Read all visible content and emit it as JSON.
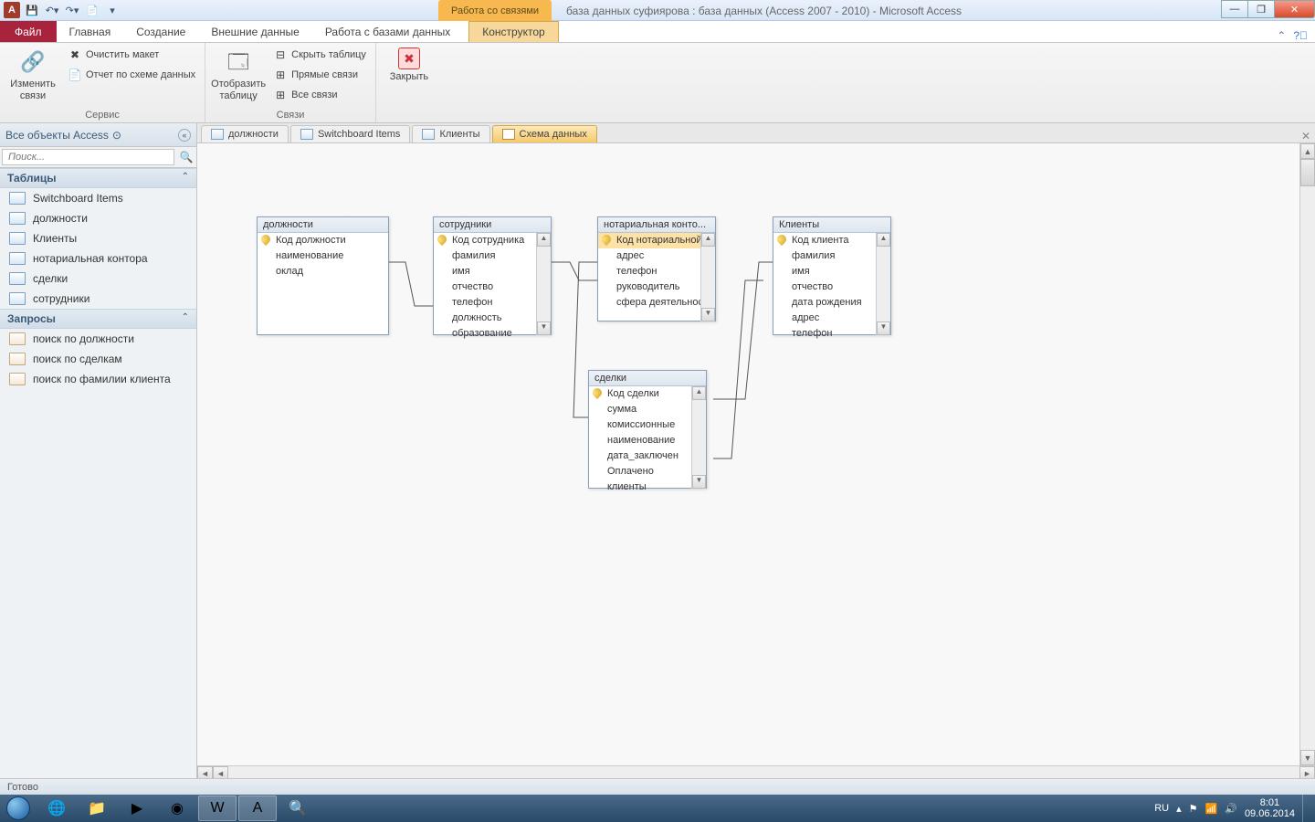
{
  "title": {
    "context_tab": "Работа со связями",
    "window_title": "база данных суфиярова : база данных (Access 2007 - 2010)  -  Microsoft Access"
  },
  "ribbon_tabs": {
    "file": "Файл",
    "home": "Главная",
    "create": "Создание",
    "external": "Внешние данные",
    "dbtools": "Работа с базами данных",
    "design": "Конструктор"
  },
  "ribbon": {
    "g1": {
      "edit_rel": "Изменить связи",
      "clear_layout": "Очистить макет",
      "rel_report": "Отчет по схеме данных",
      "label": "Сервис"
    },
    "g2": {
      "show_table": "Отобразить таблицу",
      "hide_table": "Скрыть таблицу",
      "direct_rel": "Прямые связи",
      "all_rel": "Все связи",
      "label": "Связи"
    },
    "g3": {
      "close": "Закрыть"
    }
  },
  "nav": {
    "header": "Все объекты Access",
    "search_placeholder": "Поиск...",
    "tables_hdr": "Таблицы",
    "tables": [
      "Switchboard Items",
      "должности",
      "Клиенты",
      "нотариальная контора",
      "сделки",
      "сотрудники"
    ],
    "queries_hdr": "Запросы",
    "queries": [
      "поиск по должности",
      "поиск по сделкам",
      "поиск по фамилии клиента"
    ]
  },
  "doctabs": {
    "t0": "должности",
    "t1": "Switchboard Items",
    "t2": "Клиенты",
    "t3": "Схема данных"
  },
  "rel": {
    "dolzhnosti": {
      "title": "должности",
      "f0": "Код должности",
      "f1": "наименование",
      "f2": "оклад"
    },
    "sotrudniki": {
      "title": "сотрудники",
      "f0": "Код сотрудника",
      "f1": "фамилия",
      "f2": "имя",
      "f3": "отчество",
      "f4": "телефон",
      "f5": "должность",
      "f6": "образование"
    },
    "notar": {
      "title": "нотариальная конто...",
      "f0": "Код нотариальной",
      "f1": "адрес",
      "f2": "телефон",
      "f3": "руководитель",
      "f4": "сфера деятельнос"
    },
    "klienty": {
      "title": "Клиенты",
      "f0": "Код клиента",
      "f1": "фамилия",
      "f2": "имя",
      "f3": "отчество",
      "f4": "дата рождения",
      "f5": "адрес",
      "f6": "телефон"
    },
    "sdelki": {
      "title": "сделки",
      "f0": "Код сделки",
      "f1": "сумма",
      "f2": "комиссионные",
      "f3": "наименование",
      "f4": "дата_заключен",
      "f5": "Оплачено",
      "f6": "клиенты"
    }
  },
  "status": "Готово",
  "tray": {
    "lang": "RU",
    "time": "8:01",
    "date": "09.06.2014"
  }
}
